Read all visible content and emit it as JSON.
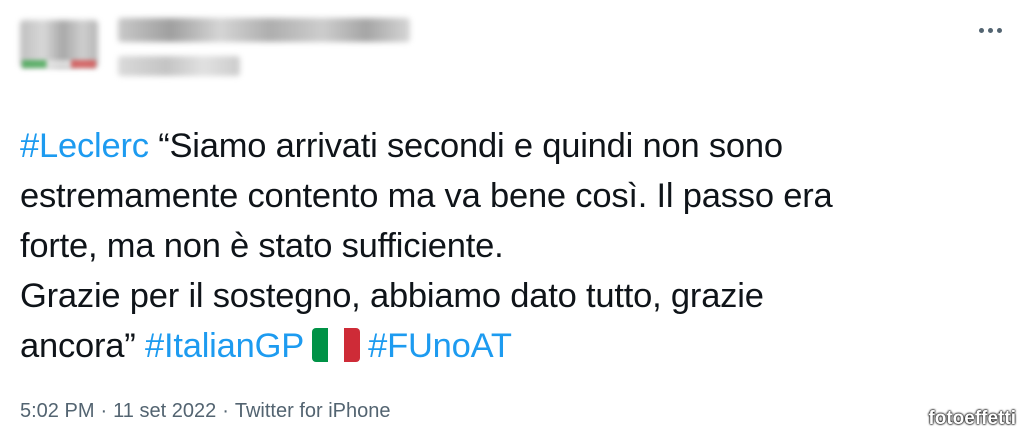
{
  "tweet": {
    "lines": [
      {
        "hashtag": "#Leclerc",
        "text": " “Siamo arrivati secondi e quindi non sono"
      },
      {
        "text": "estremamente contento ma va bene così. Il passo era"
      },
      {
        "text": "forte, ma non è stato sufficiente."
      },
      {
        "text": "Grazie per il sostegno, abbiamo dato tutto, grazie"
      },
      {
        "text": "ancora” ",
        "hashtag1": "#ItalianGP",
        "hashtag2": "#FUnoAT"
      }
    ],
    "flag_icon": "italy-flag-icon",
    "flag_colors": [
      "#009246",
      "#ffffff",
      "#ce2b37"
    ]
  },
  "meta": {
    "time": "5:02 PM",
    "separator": "·",
    "date": "11 set 2022",
    "source": "Twitter for iPhone"
  },
  "watermark": "fotoeffetti",
  "colors": {
    "hashtag": "#1d9bf0",
    "text": "#0f1419",
    "meta": "#536471"
  }
}
